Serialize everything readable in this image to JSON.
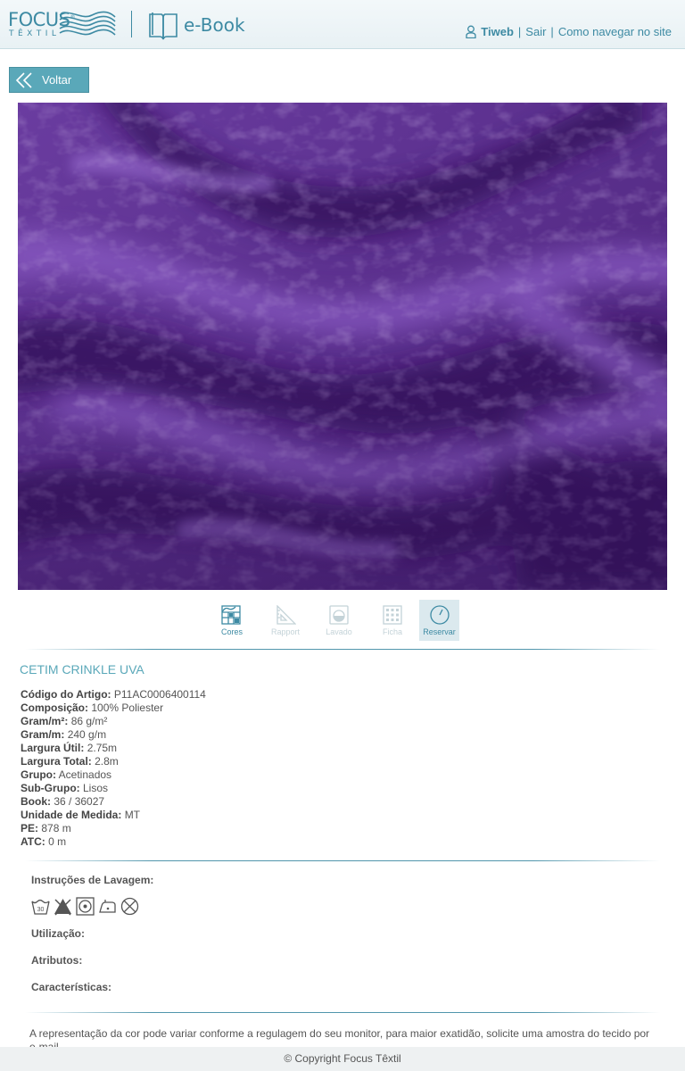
{
  "header": {
    "logo_main": "FOCUS",
    "logo_mark": "®",
    "logo_sub": "TÊXTIL",
    "section_label": "e-Book",
    "user_name": "Tiweb",
    "logout_label": "Sair",
    "help_label": "Como navegar no site",
    "separator": "|"
  },
  "back_button": {
    "label": "Voltar"
  },
  "toolbar": {
    "items": [
      {
        "label": "Cores",
        "icon": "color-grid-icon",
        "state": "active"
      },
      {
        "label": "Rapport",
        "icon": "ruler-triangle-icon",
        "state": "disabled"
      },
      {
        "label": "Lavado",
        "icon": "wash-bowl-icon",
        "state": "disabled"
      },
      {
        "label": "Ficha",
        "icon": "grid-icon",
        "state": "disabled"
      },
      {
        "label": "Reservar",
        "icon": "clock-icon",
        "state": "selected"
      }
    ]
  },
  "product": {
    "title": "CETIM CRINKLE UVA",
    "specs": [
      {
        "label": "Código do Artigo:",
        "value": "P11AC0006400114"
      },
      {
        "label": "Composição:",
        "value": "100% Poliester"
      },
      {
        "label": "Gram/m²:",
        "value": "86 g/m²"
      },
      {
        "label": "Gram/m:",
        "value": "240 g/m"
      },
      {
        "label": "Largura Útil:",
        "value": "2.75m"
      },
      {
        "label": "Largura Total:",
        "value": "2.8m"
      },
      {
        "label": "Grupo:",
        "value": "Acetinados"
      },
      {
        "label": "Sub-Grupo:",
        "value": "Lisos"
      },
      {
        "label": "Book:",
        "value": "36 / 36027"
      },
      {
        "label": "Unidade de Medida:",
        "value": "MT"
      },
      {
        "label": "PE:",
        "value": "878 m"
      },
      {
        "label": "ATC:",
        "value": "0 m"
      }
    ]
  },
  "care": {
    "title": "Instruções de Lavagem:",
    "wash_temp": "30",
    "icons": [
      "wash-30-icon",
      "no-bleach-icon",
      "tumble-dry-icon",
      "iron-low-icon",
      "no-dry-clean-icon"
    ]
  },
  "usage_label": "Utilização:",
  "attributes_label": "Atributos:",
  "characteristics_label": "Características:",
  "disclaimer": "A representação da cor pode variar conforme a regulagem do seu monitor, para maior exatidão, solicite uma amostra do tecido por e-mail.",
  "footer": {
    "copyright": "© Copyright Focus Têxtil"
  },
  "colors": {
    "accent": "#3d8aa3",
    "button": "#5aa8b9",
    "fabric": "#5a2f8c"
  }
}
